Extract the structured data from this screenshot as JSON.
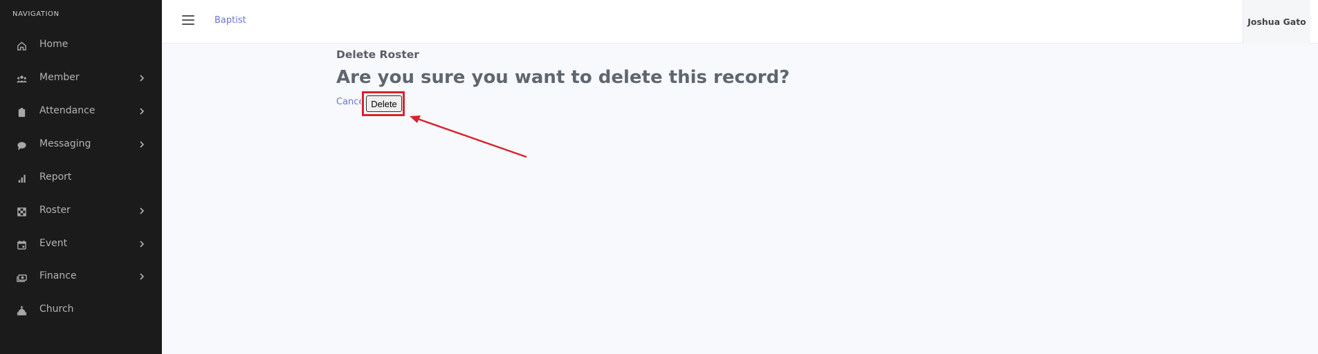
{
  "sidebar": {
    "heading": "NAVIGATION",
    "items": [
      {
        "label": "Home",
        "icon": "home-icon",
        "has_submenu": false
      },
      {
        "label": "Member",
        "icon": "users-icon",
        "has_submenu": true
      },
      {
        "label": "Attendance",
        "icon": "clipboard-icon",
        "has_submenu": true
      },
      {
        "label": "Messaging",
        "icon": "chat-bubble-icon",
        "has_submenu": true
      },
      {
        "label": "Report",
        "icon": "bar-chart-icon",
        "has_submenu": false
      },
      {
        "label": "Roster",
        "icon": "grid-icon",
        "has_submenu": true
      },
      {
        "label": "Event",
        "icon": "calendar-icon",
        "has_submenu": true
      },
      {
        "label": "Finance",
        "icon": "money-icon",
        "has_submenu": true
      },
      {
        "label": "Church",
        "icon": "church-icon",
        "has_submenu": false
      }
    ]
  },
  "header": {
    "brand": "Baptist",
    "user_name": "Joshua Gato"
  },
  "main": {
    "subtitle": "Delete Roster",
    "question": "Are you sure you want to delete this record?",
    "cancel_label": "Cancel",
    "delete_label": "Delete"
  },
  "colors": {
    "sidebar_bg": "#1b1b1b",
    "link": "#6b74d6",
    "annotation": "#d8232f",
    "page_bg": "#f8f9fc"
  }
}
